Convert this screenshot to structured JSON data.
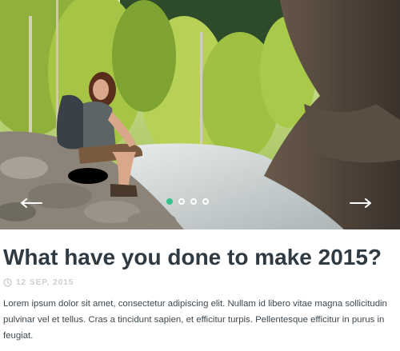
{
  "slider": {
    "image_alt": "Hiker sitting on rocks by a mountain stream",
    "slide_count": 4,
    "active_slide": 1,
    "accent_color": "#34c58e",
    "prev_icon": "arrow-left-icon",
    "next_icon": "arrow-right-icon"
  },
  "post": {
    "title": "What have you done to make 2015?",
    "date": "12 SEP, 2015",
    "date_icon": "clock-icon",
    "excerpt": "Lorem ipsum dolor sit amet, consectetur adipiscing elit. Nullam id libero vitae magna sollicitudin pulvinar vel et tellus. Cras a tincidunt sapien, et efficitur turpis. Pellentesque efficitur in purus in feugiat."
  }
}
